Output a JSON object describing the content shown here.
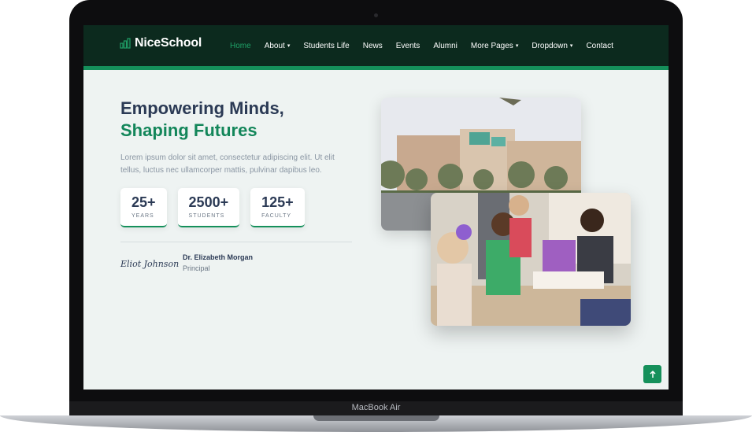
{
  "brand": {
    "name": "NiceSchool"
  },
  "nav": {
    "items": [
      {
        "label": "Home",
        "active": true,
        "dropdown": false
      },
      {
        "label": "About",
        "active": false,
        "dropdown": true
      },
      {
        "label": "Students Life",
        "active": false,
        "dropdown": false
      },
      {
        "label": "News",
        "active": false,
        "dropdown": false
      },
      {
        "label": "Events",
        "active": false,
        "dropdown": false
      },
      {
        "label": "Alumni",
        "active": false,
        "dropdown": false
      },
      {
        "label": "More Pages",
        "active": false,
        "dropdown": true
      },
      {
        "label": "Dropdown",
        "active": false,
        "dropdown": true
      },
      {
        "label": "Contact",
        "active": false,
        "dropdown": false
      }
    ]
  },
  "hero": {
    "title_line1": "Empowering Minds,",
    "title_line2": "Shaping Futures",
    "description": "Lorem ipsum dolor sit amet, consectetur adipiscing elit. Ut elit tellus, luctus nec ullamcorper mattis, pulvinar dapibus leo.",
    "stats": [
      {
        "value": "25+",
        "label": "YEARS"
      },
      {
        "value": "2500+",
        "label": "STUDENTS"
      },
      {
        "value": "125+",
        "label": "FACULTY"
      }
    ],
    "signature": "Eliot Johnson",
    "principal_name": "Dr. Elizabeth Morgan",
    "principal_role": "Principal"
  },
  "device": {
    "model_label": "MacBook Air"
  },
  "icons": {
    "brand": "chart-bar-icon",
    "dropdown": "chevron-down-icon",
    "scroll_top": "arrow-up-icon"
  },
  "colors": {
    "accent": "#15905b",
    "navbar_bg": "#0c2a1e",
    "title_dark": "#2b3a55",
    "title_green": "#13865a",
    "page_bg": "#eef3f2"
  }
}
